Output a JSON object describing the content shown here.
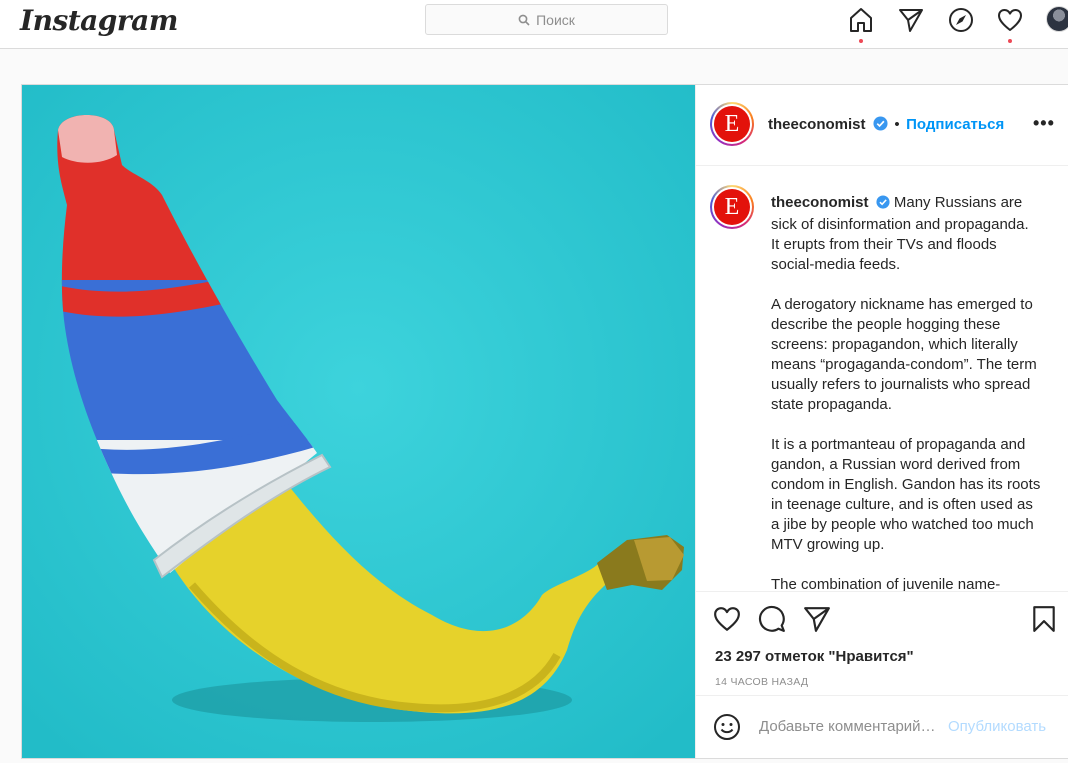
{
  "nav": {
    "logo": "Instagram",
    "search_placeholder": "Поиск",
    "icons": [
      "home-icon",
      "direct-icon",
      "explore-icon",
      "activity-icon",
      "profile-avatar"
    ]
  },
  "post": {
    "username": "theeconomist",
    "dot": "•",
    "follow_label": "Подписаться",
    "more_label": "•••",
    "avatar_letter": "E",
    "caption_paragraphs": [
      "Many Russians are sick of disinformation and propaganda. It erupts from their TVs and floods social-media feeds.",
      "A derogatory nickname has emerged to describe the people hogging these screens: propagandon, which literally means “progaganda-condom”. The term usually refers to journalists who spread state propaganda.",
      "It is a portmanteau of propaganda and gandon, a Russian word derived from condom in English. Gandon has its roots in teenage culture, and is often used as a jibe by people who watched too much MTV growing up.",
      "The combination of juvenile name-"
    ],
    "likes": "23 297 отметок \"Нравится\"",
    "timestamp": "14 ЧАСОВ НАЗАД",
    "comment_placeholder": "Добавьте комментарий…",
    "publish_label": "Опубликовать"
  },
  "colors": {
    "accent": "#0095f6",
    "notification_dot": "#ed4956",
    "photo_background": "#2ec9d3",
    "economist_red": "#e3120b"
  }
}
